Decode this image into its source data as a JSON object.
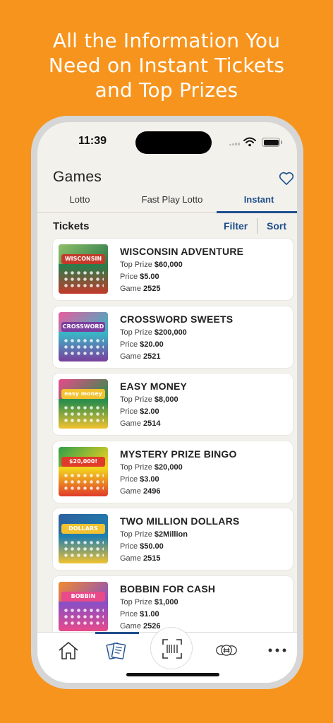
{
  "headline": {
    "line1": "All the Information You",
    "line2": "Need on Instant Tickets",
    "line3": "and Top Prizes"
  },
  "status_bar": {
    "time": "11:39"
  },
  "page": {
    "title": "Games"
  },
  "tabs": [
    {
      "label": "Lotto",
      "active": false
    },
    {
      "label": "Fast Play Lotto",
      "active": false
    },
    {
      "label": "Instant",
      "active": true
    }
  ],
  "section": {
    "title": "Tickets",
    "filter_label": "Filter",
    "sort_label": "Sort"
  },
  "labels": {
    "top_prize": "Top Prize",
    "price": "Price",
    "game": "Game"
  },
  "tickets": [
    {
      "name": "WISCONSIN ADVENTURE",
      "top_prize": "$60,000",
      "price": "$5.00",
      "game": "2525",
      "thumb_text": "WISCONSIN",
      "colors": [
        "#2e7a4a",
        "#8fbf6a",
        "#c43a2a"
      ]
    },
    {
      "name": "CROSSWORD SWEETS",
      "top_prize": "$200,000",
      "price": "$20.00",
      "game": "2521",
      "thumb_text": "CROSSWORD",
      "colors": [
        "#3bb3c4",
        "#e85c9e",
        "#7a3f9e"
      ]
    },
    {
      "name": "EASY MONEY",
      "top_prize": "$8,000",
      "price": "$2.00",
      "game": "2514",
      "thumb_text": "easy money",
      "colors": [
        "#2e8f4a",
        "#e84a8a",
        "#f2c230"
      ]
    },
    {
      "name": "MYSTERY PRIZE BINGO",
      "top_prize": "$20,000",
      "price": "$3.00",
      "game": "2496",
      "thumb_text": "$20,000!",
      "colors": [
        "#f2d21e",
        "#2e9f4a",
        "#e03a2a"
      ]
    },
    {
      "name": "TWO MILLION DOLLARS",
      "top_prize": "$2Million",
      "price": "$50.00",
      "game": "2515",
      "thumb_text": "DOLLARS",
      "colors": [
        "#1f7fae",
        "#2e5f9e",
        "#f2c230"
      ]
    },
    {
      "name": "BOBBIN FOR CASH",
      "top_prize": "$1,000",
      "price": "$1.00",
      "game": "2526",
      "thumb_text": "BOBBIN",
      "colors": [
        "#8a4fc4",
        "#f28a2e",
        "#e84a8a"
      ]
    }
  ],
  "bottom_nav": [
    {
      "name": "home-icon",
      "active": false
    },
    {
      "name": "tickets-icon",
      "active": true
    },
    {
      "name": "scan-icon",
      "active": false
    },
    {
      "name": "numbers-icon",
      "active": false
    },
    {
      "name": "more-icon",
      "active": false
    }
  ],
  "colors": {
    "background": "#f7941d",
    "accent": "#1f4f8c"
  }
}
